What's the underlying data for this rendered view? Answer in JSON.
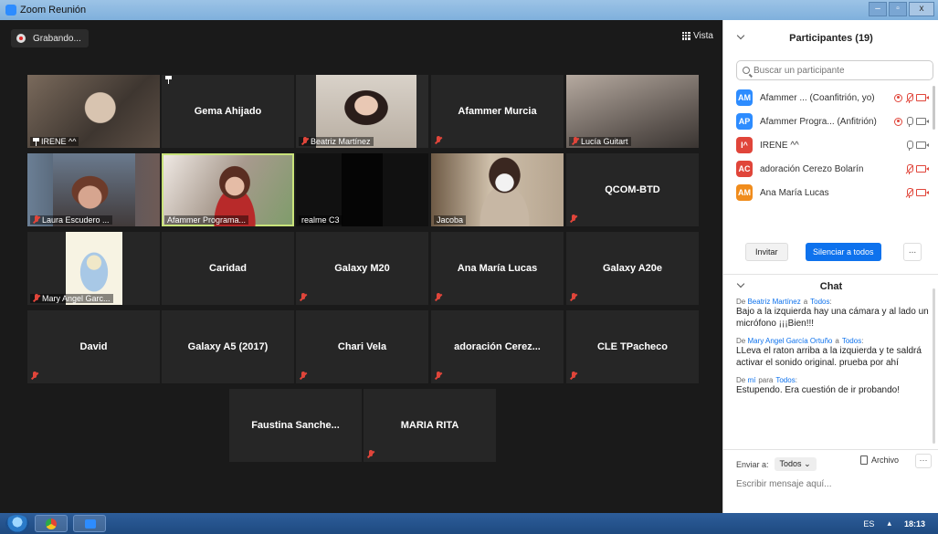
{
  "window": {
    "title": "Zoom Reunión",
    "controls": [
      "–",
      "▫",
      "x"
    ]
  },
  "toolbar": {
    "recording_label": "Grabando...",
    "view_label": "Vista"
  },
  "tiles": [
    {
      "name": "IRENE ^^",
      "caption_style": "pin-corner",
      "video": "v1"
    },
    {
      "name": "Gema Ahijado",
      "caption_style": "pin-only",
      "video": "none"
    },
    {
      "name": "Beatriz Martínez",
      "caption_style": "mic-corner",
      "video": "v3"
    },
    {
      "name": "Afammer Murcia",
      "caption_style": "mic-only",
      "video": "none"
    },
    {
      "name": "Lucía Guitart",
      "caption_style": "mic-corner",
      "video": "v5"
    },
    {
      "name": "Laura Escudero ...",
      "caption_style": "mic-corner",
      "video": "v6"
    },
    {
      "name": "Afammer Programa...",
      "caption_style": "plain",
      "video": "v7",
      "active": true
    },
    {
      "name": "realme C3",
      "caption_style": "plain",
      "video": "v8"
    },
    {
      "name": "Jacoba",
      "caption_style": "plain",
      "video": "v9"
    },
    {
      "name": "QCOM-BTD",
      "caption_style": "mic-only",
      "video": "none"
    },
    {
      "name": "Mary Angel Garc...",
      "caption_style": "mic-corner",
      "video": "v11"
    },
    {
      "name": "Caridad",
      "caption_style": "none",
      "video": "none"
    },
    {
      "name": "Galaxy M20",
      "caption_style": "mic-only",
      "video": "none"
    },
    {
      "name": "Ana María Lucas",
      "caption_style": "mic-only",
      "video": "none"
    },
    {
      "name": "Galaxy A20e",
      "caption_style": "mic-only",
      "video": "none"
    },
    {
      "name": "David",
      "caption_style": "mic-only",
      "video": "none"
    },
    {
      "name": "Galaxy A5 (2017)",
      "caption_style": "none",
      "video": "none"
    },
    {
      "name": "Chari Vela",
      "caption_style": "mic-only",
      "video": "none"
    },
    {
      "name": "adoración Cerez...",
      "caption_style": "mic-only",
      "video": "none"
    },
    {
      "name": "CLE TPacheco",
      "caption_style": "mic-only",
      "video": "none"
    },
    {
      "name": "Faustina Sanche...",
      "caption_style": "none",
      "video": "none"
    },
    {
      "name": "MARIA RITA",
      "caption_style": "mic-only",
      "video": "none"
    }
  ],
  "participants": {
    "title": "Participantes (19)",
    "search_placeholder": "Buscar un participante",
    "list": [
      {
        "initials": "AM",
        "color": "#2d8cff",
        "name": "Afammer ...  (Coanfitrión, yo)",
        "rec": true,
        "mic": "muted",
        "cam": "muted"
      },
      {
        "initials": "AP",
        "color": "#2d8cff",
        "name": "Afammer Progra...  (Anfitrión)",
        "rec": true,
        "mic": "on",
        "cam": "on"
      },
      {
        "initials": "I^",
        "color": "#e0453a",
        "name": "IRENE ^^",
        "rec": false,
        "mic": "on",
        "cam": "on"
      },
      {
        "initials": "AC",
        "color": "#e0453a",
        "name": "adoración Cerezo Bolarín",
        "rec": false,
        "mic": "muted",
        "cam": "muted"
      },
      {
        "initials": "AM",
        "color": "#f08c1c",
        "name": "Ana María Lucas",
        "rec": false,
        "mic": "muted",
        "cam": "muted"
      }
    ],
    "invite_label": "Invitar",
    "mute_all_label": "Silenciar a todos",
    "more_label": "..."
  },
  "chat": {
    "title": "Chat",
    "messages": [
      {
        "from": "Beatriz Martínez",
        "to": "Todos",
        "connector": "a",
        "text": "Bajo a la izquierda hay una cámara y al lado un micrófono ¡¡¡Bien!!!"
      },
      {
        "from": "Mary Angel García Ortuño",
        "to": "Todos",
        "connector": "a",
        "text": "LLeva el raton arriba a la izquierda y te saldrá activar el sonido original. prueba por ahí"
      },
      {
        "from": "mí",
        "to": "Todos",
        "connector": "para",
        "text": "Estupendo. Era cuestión de ir probando!"
      }
    ],
    "send_to_label": "Enviar a:",
    "send_to_value": "Todos",
    "file_label": "Archivo",
    "more_label": "···",
    "input_placeholder": "Escribir mensaje aquí..."
  },
  "taskbar": {
    "language": "ES",
    "time": "18:13"
  }
}
